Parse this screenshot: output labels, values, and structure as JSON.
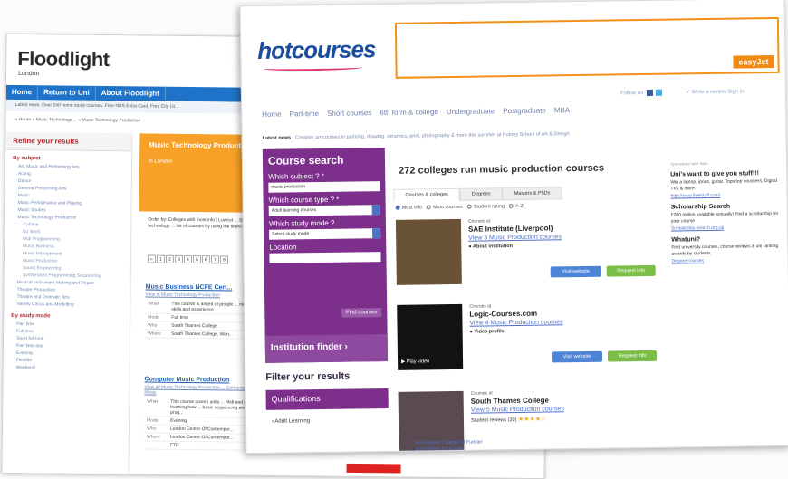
{
  "floodlight": {
    "logo": "Floodlight",
    "logo_sub": "London",
    "nav": [
      "Home",
      "Return to Uni",
      "About Floodlight"
    ],
    "latest": "Latest news:  Over 240 home study courses. Free NUS Extra Card. Free City Lit...",
    "breadcrumb": "» Home  » Music Technology ...  » Music Technology Production",
    "refine_head": "Refine your results",
    "by_subject": "By subject",
    "subjects": [
      {
        "label": "Art, Music and Performing Arts",
        "level": 0
      },
      {
        "label": "Acting",
        "level": 0
      },
      {
        "label": "Dance",
        "level": 0
      },
      {
        "label": "General Performing Arts",
        "level": 0
      },
      {
        "label": "Music",
        "level": 0
      },
      {
        "label": "Music Performance and Playing",
        "level": 0
      },
      {
        "label": "Music Studies",
        "level": 0
      },
      {
        "label": "Music Technology Production",
        "level": 0
      },
      {
        "label": "Cubase",
        "level": 1
      },
      {
        "label": "DJ Work",
        "level": 1
      },
      {
        "label": "Midi Programming",
        "level": 1
      },
      {
        "label": "Music Business",
        "level": 1
      },
      {
        "label": "Music Management",
        "level": 1
      },
      {
        "label": "Music Production",
        "level": 1
      },
      {
        "label": "Sound Engineering",
        "level": 1
      },
      {
        "label": "Synthesised Programming Sequencing",
        "level": 1
      },
      {
        "label": "Musical Instrument Making and Repair",
        "level": 0
      },
      {
        "label": "Theatre Production",
        "level": 0
      },
      {
        "label": "Theatre and Dramatic Arts",
        "level": 0
      },
      {
        "label": "Variety Circus and Modelling",
        "level": 0
      }
    ],
    "by_mode": "By study mode",
    "modes": [
      "Part time",
      "Full time",
      "Short full time",
      "Part time day",
      "Evening",
      "Flexible",
      "Weekend"
    ],
    "banner_title": "Music Technology Production courses",
    "banner_sub": "in London",
    "order_text": "Order by: Colleges with most info | Lowest ... Showing 1 - 20 of 234 music technology ... list of courses by using the filters on the ...",
    "pages": [
      "«",
      "1",
      "2",
      "3",
      "4",
      "5",
      "6",
      "7",
      "8"
    ],
    "results": [
      {
        "title": "Music Business NCFE Cert...",
        "link": "View in Music Technology Production",
        "rows": [
          {
            "k": "What",
            "v": "This course is aimed at people ... necessary skills and experience"
          },
          {
            "k": "Mode",
            "v": "Full time"
          },
          {
            "k": "Who",
            "v": "South Thames College"
          },
          {
            "k": "Where",
            "v": "South Thames College, Wan..."
          }
        ]
      },
      {
        "title": "Computer Music Production",
        "link": "View all Music Technology Production ... Contemporary Music",
        "rows": [
          {
            "k": "What",
            "v": "This course covers units ... Midi and audio, learning how ... basic sequencing and prog..."
          },
          {
            "k": "Mode",
            "v": "Evening"
          },
          {
            "k": "Who",
            "v": "London Centre Of Contempor..."
          },
          {
            "k": "Where",
            "v": "London Centre Of Contempor..."
          },
          {
            "k": "",
            "v": "FTD"
          }
        ]
      }
    ]
  },
  "hotcourses": {
    "logo": "hotcourses",
    "ad_brand": "easyJet",
    "follow": "Follow us",
    "write_review": "✓ Write a review   Sign in",
    "menu": [
      "Home",
      "Part-time",
      "Short courses",
      "6th form & college",
      "Undergraduate",
      "Postgraduate",
      "MBA"
    ],
    "news_label": "Latest news :",
    "news_text": " Creative art courses in painting, drawing, ceramics, print, photography & more this summer at Putney School of Art & Design",
    "search": {
      "title": "Course search",
      "subject_label": "Which subject ? *",
      "subject_value": "music production",
      "type_label": "Which course type ? *",
      "type_value": "Adult learning courses",
      "mode_label": "Which study mode ?",
      "mode_value": "Select study mode",
      "location_label": "Location",
      "location_value": "",
      "find_button": "Find courses"
    },
    "institution_finder": "Institution finder ›",
    "filter_title": "Filter your results",
    "qualifications": "Qualifications",
    "adult_learning": "› Adult Learning",
    "headline": "272 colleges run music production courses",
    "tabs": [
      "Courses & colleges",
      "Degrees",
      "Masters & PhDs"
    ],
    "sort": [
      "Most info",
      "Most courses",
      "Student rating",
      "A-Z"
    ],
    "results": [
      {
        "courses_at": "Courses at",
        "name": "SAE Institute (Liverpool)",
        "view": "View 3 Music Production courses",
        "about": "About institution",
        "visit": "Visit website",
        "request": "Request info"
      },
      {
        "courses_at": "Courses at",
        "name": "Logic-Courses.com",
        "view": "View 4 Music Production courses",
        "about": "Video profile",
        "play": "Play video",
        "visit": "Visit website",
        "request": "Request info"
      },
      {
        "courses_at": "Courses at",
        "name": "South Thames College",
        "view": "View 5 Music Production courses",
        "reviews": "Student reviews (20)",
        "stars": "★★★★☆"
      }
    ],
    "sidebar": {
      "sponsored": "Sponsored web links",
      "block1_title": "Uni's want to give you stuff!!!",
      "block1_text": "Win a laptop, ipods, guitar, Topshop vouchers, Digital TVs & more.",
      "block1_url": "http://www.freestuff.com/",
      "block2_title": "Scholarship Search",
      "block2_text": "£200 million available annually! Find a scholarship for your course",
      "block2_url": "Scholarship-search.org.uk",
      "block3_title": "Whatuni?",
      "block3_text": "Find university courses, course reviews & uni ranking awards by students",
      "block3_url": "Degree courses"
    },
    "bottom_links": [
      "Kensington College Of Further",
      "And Higher Education"
    ]
  }
}
